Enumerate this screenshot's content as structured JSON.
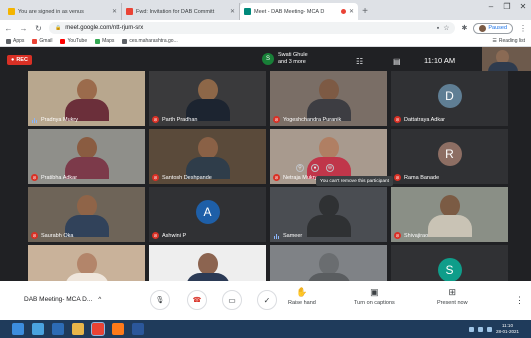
{
  "browser": {
    "tabs": [
      {
        "title": "You are signed in as venus",
        "favicon_color": "#f4b400",
        "active": false
      },
      {
        "title": "Fwd: Invitation for DAB Committ",
        "favicon_color": "#ea4335",
        "active": false
      },
      {
        "title": "Meet - DAB Meeting- MCA D",
        "favicon_color": "#00897b",
        "active": true,
        "recording": true
      }
    ],
    "new_tab": "+",
    "window_controls": [
      "–",
      "❐",
      "✕"
    ],
    "url": "meet.google.com/ntt-rjum-srx",
    "profile_status": "Paused",
    "bookmarks": [
      {
        "label": "Apps",
        "color": "#5f6368"
      },
      {
        "label": "Gmail",
        "color": "#ea4335"
      },
      {
        "label": "YouTube",
        "color": "#ff0000"
      },
      {
        "label": "Maps",
        "color": "#34a853"
      },
      {
        "label": "ces.maharashtra.go...",
        "color": "#5f6368"
      }
    ],
    "reading_list": "Reading list"
  },
  "meet": {
    "rec_label": "REC",
    "presenter": {
      "initial": "S",
      "name": "Swati Ghule",
      "more": "and 3 more"
    },
    "time": "11:10 AM",
    "tooltip": "You can't remove this participant",
    "participants": [
      {
        "name": "Pradnya Mukry",
        "type": "video",
        "state": "talk",
        "bg": "#b8a78e",
        "skin": "#9b6b4c",
        "cloth": "#6b2f3a"
      },
      {
        "name": "Parth Pradhan",
        "type": "video",
        "state": "mute",
        "bg": "#3a3a3c",
        "skin": "#8d6748",
        "cloth": "#1c2430"
      },
      {
        "name": "Yogeshchandra Puranik",
        "type": "video",
        "state": "mute",
        "bg": "#7a6e66",
        "skin": "#7d5a44",
        "cloth": "#3d3d42"
      },
      {
        "name": "Dattatraya Adkar",
        "type": "avatar",
        "state": "mute",
        "initial": "D",
        "avatar_color": "#5f7e94"
      },
      {
        "name": "Pratibha Adkar",
        "type": "video",
        "state": "mute",
        "bg": "#8f8f8a",
        "skin": "#8a5c41",
        "cloth": "#7c3a4a"
      },
      {
        "name": "Santosh Deshpande",
        "type": "video",
        "state": "mute",
        "bg": "#5a4a3a",
        "skin": "#8a6146",
        "cloth": "#2f3d4a"
      },
      {
        "name": "Netraja Mukry",
        "type": "video",
        "state": "mute",
        "bg": "#a89a8e",
        "skin": "#b07f63",
        "cloth": "#c0364a"
      },
      {
        "name": "Rama Banade",
        "type": "avatar",
        "state": "mute",
        "initial": "R",
        "avatar_color": "#8d6e63"
      },
      {
        "name": "Saurabh Oka",
        "type": "video",
        "state": "mute",
        "bg": "#6e6458",
        "skin": "#8f6448",
        "cloth": "#31425a"
      },
      {
        "name": "Ashwini P",
        "type": "avatar",
        "state": "mute",
        "initial": "A",
        "avatar_color": "#1e5fa8"
      },
      {
        "name": "Sameer",
        "type": "video",
        "state": "talk",
        "bg": "#4a4d52",
        "skin": "#2f3133",
        "cloth": "#2f3133"
      },
      {
        "name": "Shivajirao",
        "type": "video",
        "state": "mute",
        "bg": "#8a8f86",
        "skin": "#7b5b44",
        "cloth": "#c9c3b5"
      },
      {
        "name": "shambhavi gupte",
        "type": "video",
        "state": "mute",
        "bg": "#c9b29a",
        "skin": "#b3856a",
        "cloth": "#efe6dc"
      },
      {
        "name": "Shripad Bhide",
        "type": "video",
        "state": "mute",
        "bg": "#eeeeee",
        "skin": "#8c6450",
        "cloth": "#2b3a55"
      },
      {
        "name": "Rajendra Patil",
        "type": "video",
        "state": "mute",
        "bg": "#7f8286",
        "skin": "#6a6d70",
        "cloth": "#5a5d60"
      },
      {
        "name": "Sameer I Bapat",
        "type": "avatar",
        "state": "mute",
        "initial": "S",
        "avatar_color": "#0f9d8a"
      }
    ]
  },
  "bottom_bar": {
    "meeting_name": "DAB Meeting- MCA D...",
    "chevron": "^",
    "controls": {
      "mic": "🎙",
      "hangup": "☎",
      "camera": "▭",
      "check": "✓"
    },
    "raise_hand": "Raise hand",
    "captions": "Turn on captions",
    "present": "Present now",
    "more": "⋮"
  },
  "taskbar": {
    "apps": [
      {
        "name": "start",
        "color": "#3c8dde"
      },
      {
        "name": "edge",
        "color": "#4aa3df"
      },
      {
        "name": "store",
        "color": "#2d6cb5"
      },
      {
        "name": "explorer",
        "color": "#e8b64a"
      },
      {
        "name": "chrome",
        "color": "#e94335"
      },
      {
        "name": "firefox",
        "color": "#ff7a1a"
      },
      {
        "name": "word",
        "color": "#2b579a"
      }
    ],
    "time": "11:10",
    "date": "28-01-2021"
  }
}
